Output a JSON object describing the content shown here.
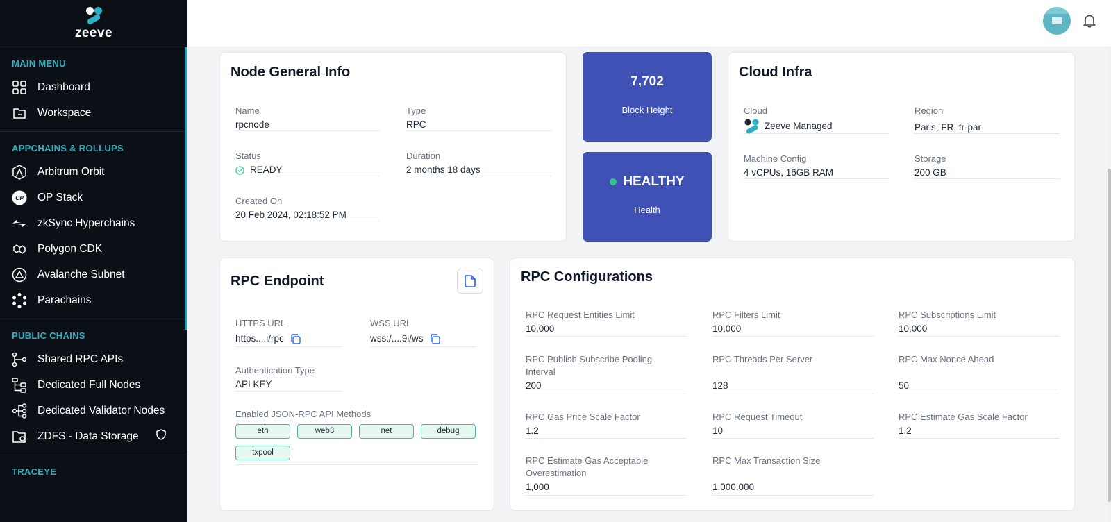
{
  "brand": {
    "name": "zeeve"
  },
  "sidebar": {
    "main_menu": {
      "title": "MAIN MENU",
      "items": [
        {
          "label": "Dashboard",
          "icon": "grid-icon"
        },
        {
          "label": "Workspace",
          "icon": "folder-icon"
        }
      ]
    },
    "appchains": {
      "title": "APPCHAINS & ROLLUPS",
      "items": [
        {
          "label": "Arbitrum Orbit",
          "icon": "arbitrum-icon"
        },
        {
          "label": "OP Stack",
          "icon": "op-icon",
          "badge": "OP"
        },
        {
          "label": "zkSync Hyperchains",
          "icon": "zksync-icon"
        },
        {
          "label": "Polygon CDK",
          "icon": "polygon-icon"
        },
        {
          "label": "Avalanche Subnet",
          "icon": "avalanche-icon"
        },
        {
          "label": "Parachains",
          "icon": "polkadot-icon"
        }
      ]
    },
    "public_chains": {
      "title": "PUBLIC CHAINS",
      "items": [
        {
          "label": "Shared RPC APIs",
          "icon": "share-nodes-icon"
        },
        {
          "label": "Dedicated Full Nodes",
          "icon": "tree-nodes-icon"
        },
        {
          "label": "Dedicated Validator Nodes",
          "icon": "validator-nodes-icon"
        },
        {
          "label": "ZDFS - Data Storage",
          "icon": "storage-folder-icon"
        }
      ]
    },
    "traceye": {
      "title": "TRACEYE"
    }
  },
  "node_general": {
    "title": "Node General Info",
    "name_label": "Name",
    "name_value": "rpcnode",
    "type_label": "Type",
    "type_value": "RPC",
    "status_label": "Status",
    "status_value": "READY",
    "duration_label": "Duration",
    "duration_value": "2 months 18 days",
    "created_label": "Created On",
    "created_value": "20 Feb 2024, 02:18:52 PM"
  },
  "block_height": {
    "value": "7,702",
    "label": "Block Height"
  },
  "health": {
    "value": "HEALTHY",
    "label": "Health",
    "dot_color": "#34c38f"
  },
  "cloud_infra": {
    "title": "Cloud Infra",
    "cloud_label": "Cloud",
    "cloud_value": "Zeeve Managed",
    "region_label": "Region",
    "region_value": "Paris, FR, fr-par",
    "machine_label": "Machine Config",
    "machine_value": "4 vCPUs, 16GB RAM",
    "storage_label": "Storage",
    "storage_value": "200 GB"
  },
  "rpc_endpoint": {
    "title": "RPC Endpoint",
    "https_label": "HTTPS URL",
    "https_value": "https....i/rpc",
    "wss_label": "WSS URL",
    "wss_value": "wss:/....9i/ws",
    "auth_label": "Authentication Type",
    "auth_value": "API KEY",
    "methods_label": "Enabled JSON-RPC API Methods",
    "methods": [
      "eth",
      "web3",
      "net",
      "debug",
      "txpool"
    ]
  },
  "rpc_config": {
    "title": "RPC Configurations",
    "items": [
      {
        "label": "RPC Request Entities Limit",
        "value": "10,000"
      },
      {
        "label": "RPC Filters Limit",
        "value": "10,000"
      },
      {
        "label": "RPC Subscriptions Limit",
        "value": "10,000"
      },
      {
        "label": "RPC Publish Subscribe Pooling Interval",
        "value": "200"
      },
      {
        "label": "RPC Threads Per Server",
        "value": "128"
      },
      {
        "label": "RPC Max Nonce Ahead",
        "value": "50"
      },
      {
        "label": "RPC Gas Price Scale Factor",
        "value": "1.2"
      },
      {
        "label": "RPC Request Timeout",
        "value": "10"
      },
      {
        "label": "RPC Estimate Gas Scale Factor",
        "value": "1.2"
      },
      {
        "label": "RPC Estimate Gas Acceptable Overestimation",
        "value": "1,000"
      },
      {
        "label": "RPC Max Transaction Size",
        "value": "1,000,000"
      }
    ]
  },
  "colors": {
    "accent": "#2bb0c4",
    "stat_bg": "#3f51b5",
    "sidebar_bg": "#0b1016"
  }
}
